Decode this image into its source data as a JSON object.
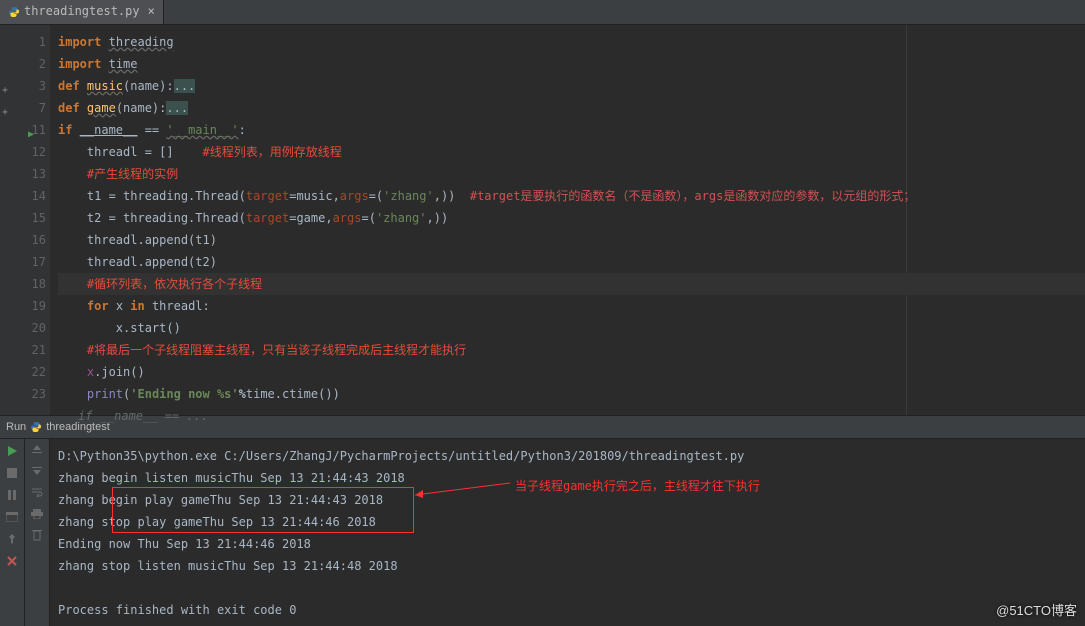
{
  "tab": {
    "label": "threadingtest.py",
    "close": "×"
  },
  "gutter": [
    "1",
    "2",
    "3",
    "7",
    "11",
    "12",
    "13",
    "14",
    "15",
    "16",
    "17",
    "18",
    "19",
    "20",
    "21",
    "22",
    "23",
    ""
  ],
  "breadcrumb": "if __name__ == ...",
  "code": {
    "l1": {
      "kw": "import",
      "mod": "threading"
    },
    "l2": {
      "kw": "import",
      "mod": "time"
    },
    "l3": {
      "kw": "def ",
      "fn": "music",
      "sig": "(name):",
      "fold": "..."
    },
    "l7": {
      "kw": "def ",
      "fn": "game",
      "sig": "(name):",
      "fold": "..."
    },
    "l11": {
      "kw": "if ",
      "var": "__name__",
      "op": " == ",
      "str": "'__main__'",
      "colon": ":"
    },
    "l12": {
      "lhs": "threadl = []    ",
      "cmt": "#线程列表，用例存放线程"
    },
    "l13": {
      "cmt": "#产生线程的实例"
    },
    "l14": {
      "pre": "t1 = threading.Thread(",
      "k1": "target",
      "v1": "=music,",
      "k2": "args",
      "v2": "=(",
      "str": "'zhang'",
      "tail": ",))  ",
      "cmt": "#target是要执行的函数名（不是函数），args是函数对应的参数，以元组的形式；"
    },
    "l15": {
      "pre": "t2 = threading.Thread(",
      "k1": "target",
      "v1": "=game,",
      "k2": "args",
      "v2": "=(",
      "str": "'zhang'",
      "tail": ",))"
    },
    "l16": {
      "txt": "threadl.append(t1)"
    },
    "l17": {
      "txt": "threadl.append(t2)"
    },
    "l18": {
      "cmt": "#循环列表，依次执行各个子线程"
    },
    "l19": {
      "kw": "for ",
      "var": "x",
      "kw2": " in ",
      "it": "threadl:",
      "pad": ""
    },
    "l20": {
      "txt": "x.start()"
    },
    "l21": {
      "cmt": "#将最后一个子线程阻塞主线程，只有当该子线程完成后主线程才能执行"
    },
    "l22": {
      "txt": "x.join()"
    },
    "l23": {
      "fn": "print",
      "p1": "(",
      "str": "'Ending now %s'",
      "op": "%",
      "call": "time.ctime())"
    }
  },
  "run_header": {
    "label": "Run",
    "name": "threadingtest"
  },
  "console": {
    "o1": "D:\\Python35\\python.exe C:/Users/ZhangJ/PycharmProjects/untitled/Python3/201809/threadingtest.py",
    "o2": "zhang begin listen musicThu Sep 13 21:44:43 2018",
    "o3": "zhang begin play gameThu Sep 13 21:44:43 2018",
    "o4": "zhang stop play gameThu Sep 13 21:44:46 2018",
    "o5": "Ending now Thu Sep 13 21:44:46 2018",
    "o6": "zhang stop listen musicThu Sep 13 21:44:48 2018",
    "o7": "",
    "o8": "Process finished with exit code 0"
  },
  "annotation": {
    "text": "当子线程game执行完之后，主线程才往下执行"
  },
  "watermark": "@51CTO博客"
}
